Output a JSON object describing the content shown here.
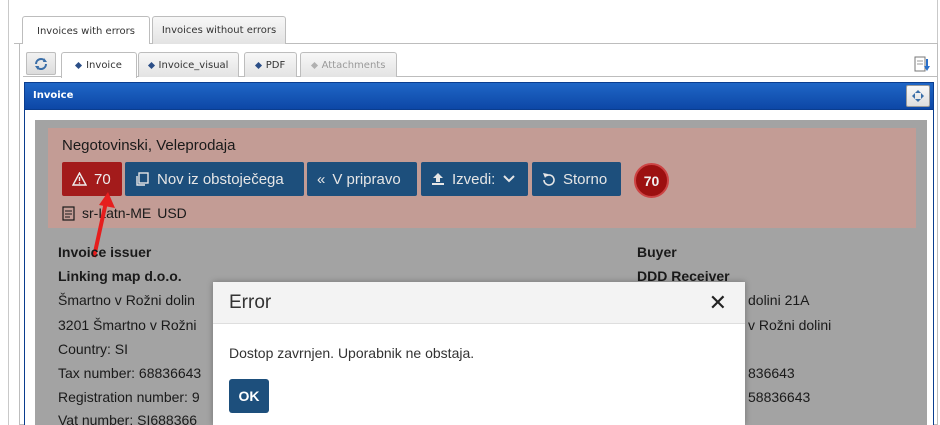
{
  "outer_tabs": [
    {
      "label": "Invoices with errors",
      "active": true
    },
    {
      "label": "Invoices without errors",
      "active": false
    }
  ],
  "inner_tabs": [
    {
      "label": "Invoice",
      "active": true
    },
    {
      "label": "Invoice_visual",
      "active": false
    },
    {
      "label": "PDF",
      "active": false
    },
    {
      "label": "Attachments",
      "active": false,
      "disabled": true
    }
  ],
  "panel": {
    "title": "Invoice"
  },
  "document": {
    "company": "Negotovinski, Veleprodaja",
    "buttons": {
      "error_count": "70",
      "copy": "Nov iz obstoječega",
      "prepare": "V pripravo",
      "export": "Izvedi:",
      "cancel": "Storno"
    },
    "badge_count": "70",
    "language": "sr-Latn-ME",
    "currency": "USD",
    "issuer": {
      "heading": "Invoice issuer",
      "name": "Linking map d.o.o.",
      "address1": "Šmartno v Rožni dolin",
      "address2": "3201 Šmartno v Rožni",
      "country": "Country:  SI",
      "tax": "Tax number: 68836643",
      "registration": "Registration number: 9",
      "vat": "Vat number: SI688366"
    },
    "buyer": {
      "heading": "Buyer",
      "name": "DDD Receiver",
      "address1": "dolini 21A",
      "address2": "v Rožni dolini",
      "tax": "836643",
      "registration": "58836643"
    }
  },
  "modal": {
    "title": "Error",
    "close": "✕",
    "message": "Dostop zavrnjen. Uporabnik ne obstaja.",
    "ok_label": "OK"
  },
  "colors": {
    "header_blue": "#0d47a6",
    "button_navy": "#1d4f7c",
    "error_red": "#a31b1b"
  }
}
